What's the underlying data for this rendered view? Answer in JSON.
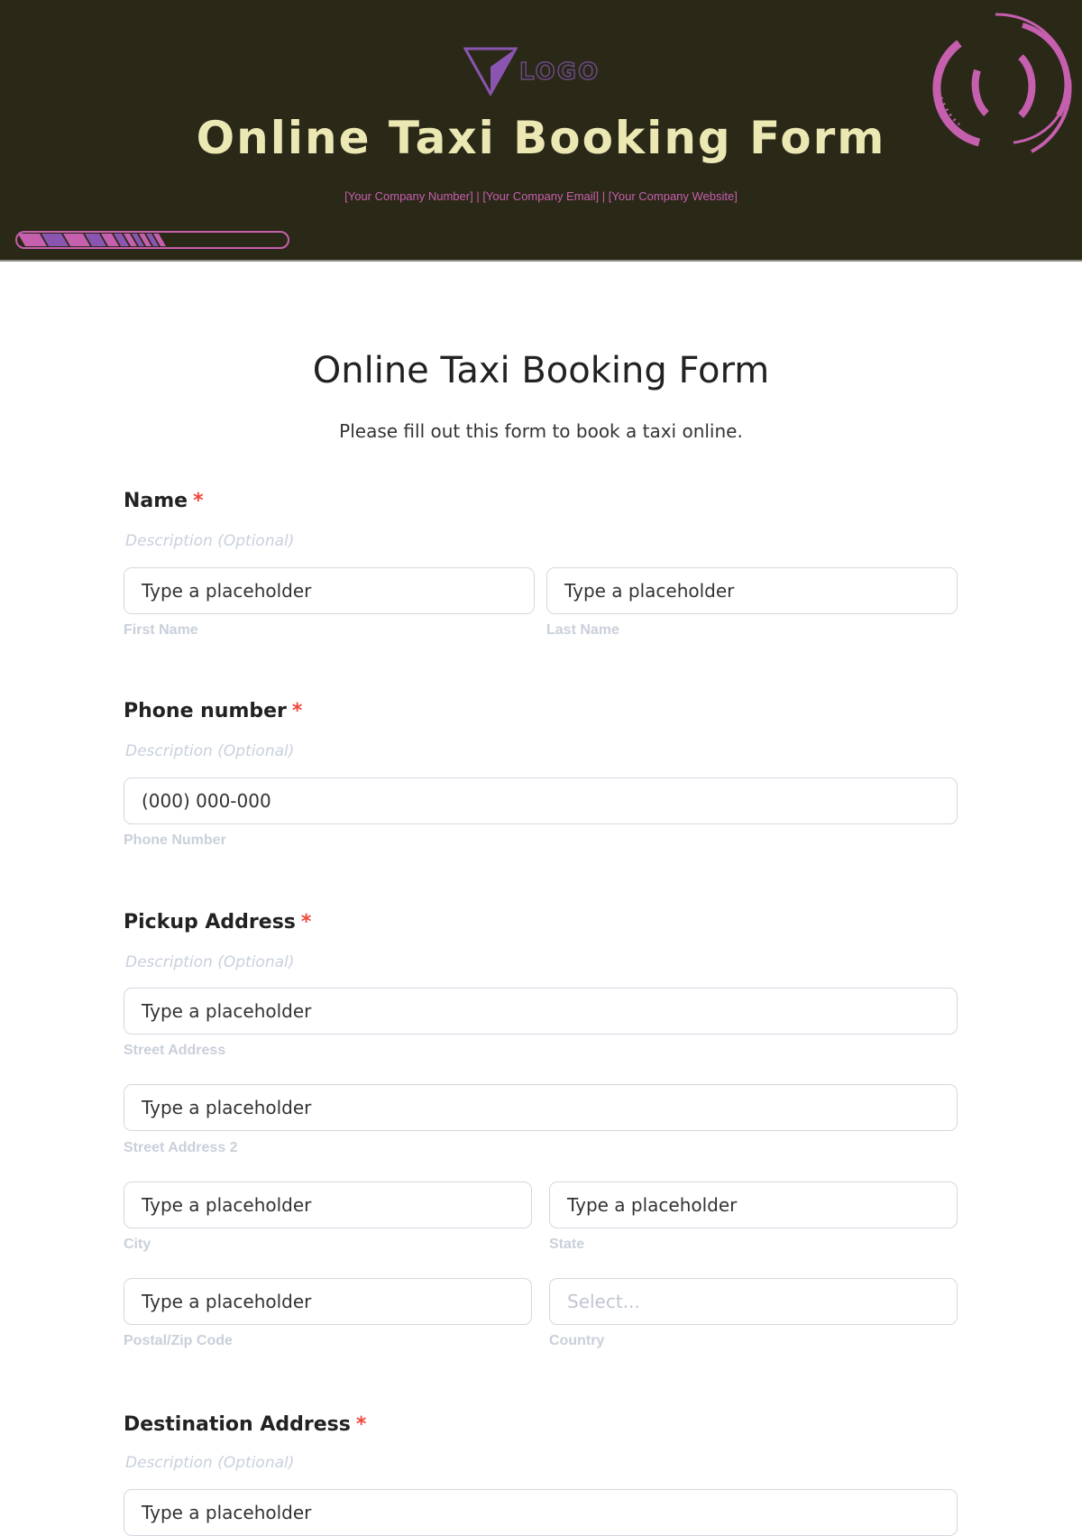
{
  "header": {
    "logo_text": "LOGO",
    "title": "Online Taxi Booking Form",
    "contact": "[Your Company Number]  |  [Your Company Email]  |  [Your Company Website]",
    "accent": "#c65fae",
    "accent2": "#8a55b0",
    "progress": 0.65
  },
  "form": {
    "title": "Online Taxi Booking Form",
    "subtitle": "Please fill out this form to book a taxi online.",
    "required_mark": "*",
    "description": "Description (Optional)",
    "name": {
      "label": "Name",
      "first": {
        "placeholder": "Type a placeholder",
        "sublabel": "First Name"
      },
      "last": {
        "placeholder": "Type a placeholder",
        "sublabel": "Last Name"
      }
    },
    "phone": {
      "label": "Phone number",
      "placeholder": "(000) 000-000",
      "sublabel": "Phone Number"
    },
    "pickup": {
      "label": "Pickup Address",
      "street": {
        "placeholder": "Type a placeholder",
        "sublabel": "Street Address"
      },
      "street2": {
        "placeholder": "Type a placeholder",
        "sublabel": "Street Address 2"
      },
      "city": {
        "placeholder": "Type a placeholder",
        "sublabel": "City"
      },
      "state": {
        "placeholder": "Type a placeholder",
        "sublabel": "State"
      },
      "postal": {
        "placeholder": "Type a placeholder",
        "sublabel": "Postal/Zip Code"
      },
      "country": {
        "placeholder": "Select...",
        "sublabel": "Country"
      }
    },
    "destination": {
      "label": "Destination Address",
      "street": {
        "placeholder": "Type a placeholder"
      }
    }
  }
}
